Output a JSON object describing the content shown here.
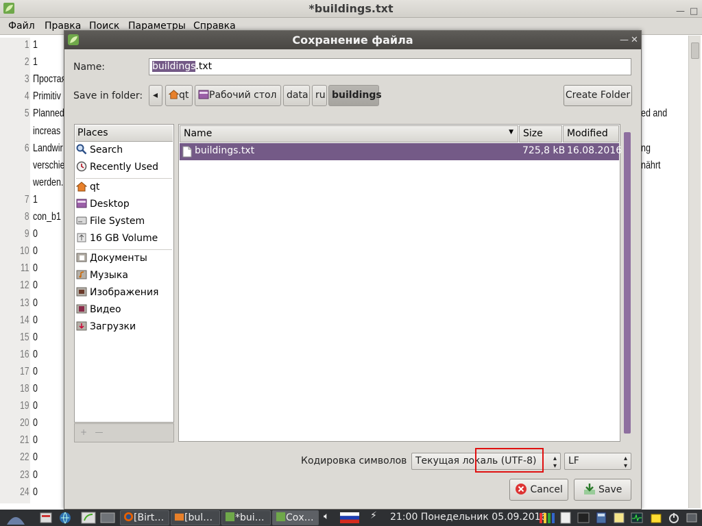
{
  "main_window": {
    "title": "*buildings.txt",
    "menu": [
      "Файл",
      "Правка",
      "Поиск",
      "Параметры",
      "Справка"
    ],
    "gutter_numbers": [
      "1",
      "2",
      "3",
      "4",
      "5",
      "",
      "6",
      "",
      "",
      "7",
      "8",
      "9",
      "10",
      "11",
      "12",
      "13",
      "14",
      "15",
      "16",
      "17",
      "18",
      "19",
      "20",
      "21",
      "22",
      "23",
      "24"
    ],
    "text_lines": [
      "1",
      "1",
      "Простая",
      "Primitiv",
      "Planned",
      "increas",
      "Landwir",
      "verschie",
      "werden.",
      "1",
      "con_b1",
      "0",
      "0",
      "0",
      "0",
      "0",
      "0",
      "0",
      "0",
      "0",
      "0",
      "0",
      "0",
      "0",
      "0",
      "0",
      "0"
    ],
    "right_text": [
      "ed and",
      "ng",
      "nährt"
    ]
  },
  "dialog": {
    "title": "Сохранение файла",
    "name_label": "Name:",
    "name_selected": "buildings",
    "name_rest": ".txt",
    "save_in_label": "Save in folder:",
    "breadcrumbs": [
      "qt",
      "Рабочий стол",
      "data",
      "ru",
      "buildings"
    ],
    "create_folder": "Create Folder",
    "places_header": "Places",
    "places_group1": [
      "Search",
      "Recently Used"
    ],
    "places_group2": [
      "qt",
      "Desktop",
      "File System",
      "16 GB Volume"
    ],
    "places_group3": [
      "Документы",
      "Музыка",
      "Изображения",
      "Видео",
      "Загрузки"
    ],
    "columns": {
      "name": "Name",
      "size": "Size",
      "modified": "Modified"
    },
    "files": [
      {
        "name": "buildings.txt",
        "size": "725,8 kB",
        "modified": "16.08.2016"
      }
    ],
    "encoding_label": "Кодировка символов",
    "encoding_value": "Текущая локаль (UTF-8)",
    "line_ending": "LF",
    "cancel": "Cancel",
    "save": "Save"
  },
  "taskbar": {
    "tasks": [
      "[Birt…",
      "[bul…",
      "*bui…",
      "Сох…"
    ],
    "clock": "21:00 Понедельник 05.09.2016"
  },
  "colors": {
    "selection": "#745a87",
    "highlight_box": "#e01010"
  }
}
